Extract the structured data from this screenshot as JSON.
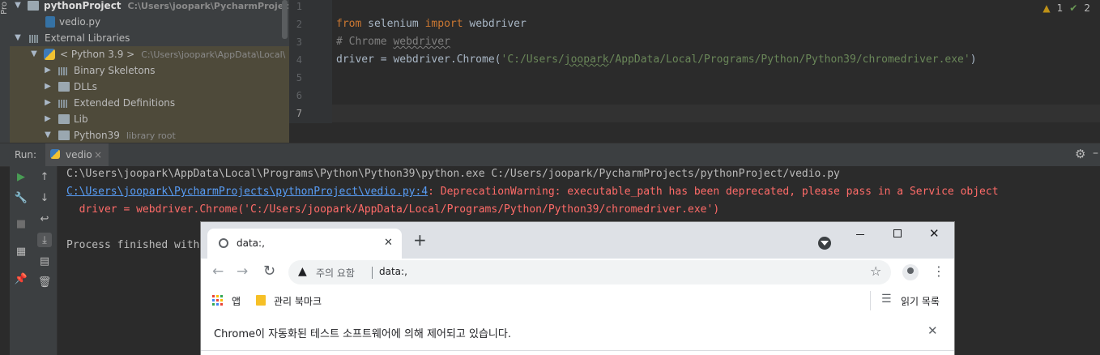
{
  "left_strip": {
    "label": "Pro"
  },
  "project_tree": {
    "items": [
      {
        "label": "pythonProject",
        "hint": "C:\\Users\\joopark\\PycharmProjects\\py"
      },
      {
        "label": "vedio.py",
        "hint": ""
      },
      {
        "label": "External Libraries",
        "hint": ""
      },
      {
        "label": "< Python 3.9 >",
        "hint": "C:\\Users\\joopark\\AppData\\Local\\"
      },
      {
        "label": "Binary Skeletons",
        "hint": ""
      },
      {
        "label": "DLLs",
        "hint": ""
      },
      {
        "label": "Extended Definitions",
        "hint": ""
      },
      {
        "label": "Lib",
        "hint": ""
      },
      {
        "label": "Python39",
        "hint": "library root"
      }
    ]
  },
  "editor": {
    "line_numbers": [
      "1",
      "2",
      "3",
      "4",
      "5",
      "6",
      "7"
    ],
    "line2_kw_from": "from",
    "line2_module": " selenium ",
    "line2_kw_import": "import",
    "line2_name": " webdriver",
    "line3_comment_prefix": "# Chrome ",
    "line3_comment_word": "webdriver",
    "line4_prefix": "driver = webdriver.Chrome(",
    "line4_str_a": "'C:/Users/",
    "line4_str_user": "joopark",
    "line4_str_b": "/AppData/Local/Programs/Python/Python39/chromedriver.exe'",
    "line4_suffix": ")",
    "warnings_count": "1",
    "ok_count": "2",
    "warning_icon": "warning-triangle-icon",
    "ok_icon": "double-check-icon"
  },
  "run_bar": {
    "label": "Run:",
    "tab_label": "vedio",
    "close_glyph": "×",
    "settings_icon": "gear-icon"
  },
  "console": {
    "line1": "C:\\Users\\joopark\\AppData\\Local\\Programs\\Python\\Python39\\python.exe C:/Users/joopark/PycharmProjects/pythonProject/vedio.py",
    "line2_link": "C:\\Users\\joopark\\PycharmProjects\\pythonProject\\vedio.py:4",
    "line2_text": ": DeprecationWarning: executable_path has been deprecated, please pass in a Service object",
    "line3": "  driver = webdriver.Chrome('C:/Users/joopark/AppData/Local/Programs/Python/Python39/chromedriver.exe')",
    "line5": "Process finished with"
  },
  "chrome": {
    "tab_title": "data:,",
    "tab_close": "✕",
    "new_tab": "+",
    "security_label": "주의 요함",
    "address": "data:,",
    "bookmark_apps": "앱",
    "bookmark_managed": "관리 북마크",
    "reading_list": "읽기 목록",
    "infobar_text": "Chrome이 자동화된 테스트 소프트웨어에 의해 제어되고 있습니다.",
    "infobar_close": "✕"
  }
}
